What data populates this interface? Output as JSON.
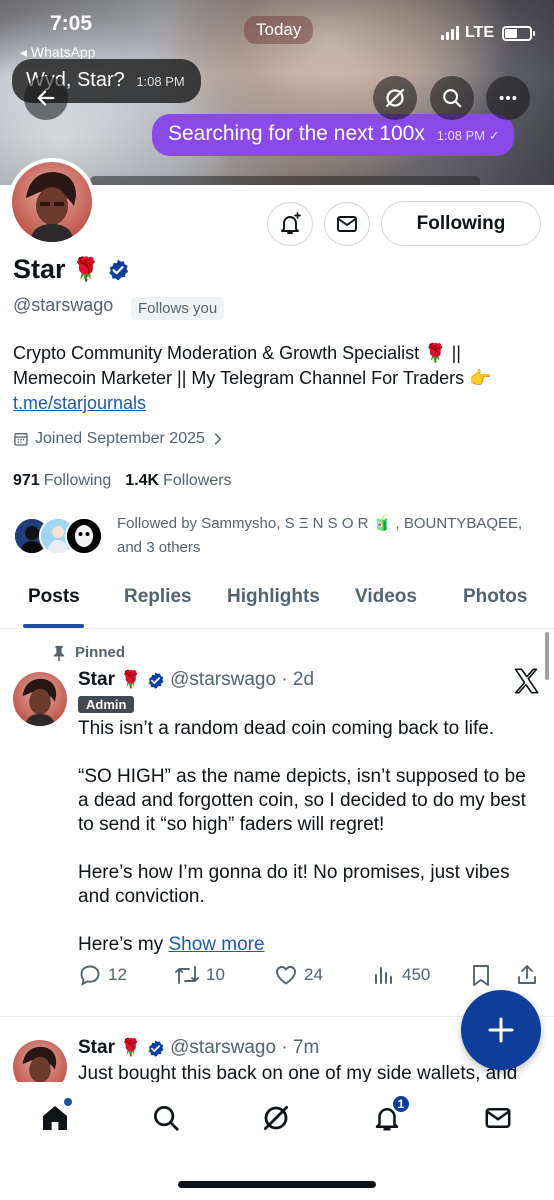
{
  "status_bar": {
    "time": "7:05",
    "back_app": "◂ WhatsApp",
    "network": "LTE"
  },
  "banner_overlay": {
    "date_pill": "Today",
    "incoming_message": "Wyd, Star?",
    "incoming_time": "1:08 PM",
    "outgoing_message": "Searching for the next 100x",
    "outgoing_time": "1:08 PM ✓"
  },
  "profile": {
    "name": "Star",
    "name_emoji": "🌹",
    "handle": "@starswago",
    "follows_you": "Follows you",
    "following_button": "Following",
    "bio_line1": "Crypto Community Moderation & Growth Specialist 🌹 ||",
    "bio_line2": "Memecoin Marketer || My Telegram Channel For Traders 👉",
    "bio_link": "t.me/starjournals",
    "joined": "Joined September 2025",
    "following_count": "971",
    "following_label": "Following",
    "followers_count": "1.4K",
    "followers_label": "Followers",
    "followed_by": "Followed by Sammysho, S Ξ N S O R 🧃 , BOUNTYBAQEE, and 3 others"
  },
  "tabs": [
    {
      "label": "Posts"
    },
    {
      "label": "Replies"
    },
    {
      "label": "Highlights"
    },
    {
      "label": "Videos"
    },
    {
      "label": "Photos"
    }
  ],
  "pinned_post": {
    "pinned_label": "Pinned",
    "name": "Star",
    "name_emoji": "🌹",
    "handle_time": "@starswago · 2d",
    "badge": "Admin",
    "p1": "This isn’t a random dead coin coming back to life.",
    "p2": "“SO HIGH” as the name depicts, isn’t supposed to be a dead and forgotten coin, so I decided to do my best to send it “so high” faders will regret!",
    "p3": "Here’s how I’m gonna do it! No promises, just vibes and conviction.",
    "p4": "Here’s my ",
    "show_more": "Show more",
    "replies": "12",
    "reposts": "10",
    "likes": "24",
    "views": "450"
  },
  "second_post": {
    "name": "Star",
    "name_emoji": "🌹",
    "handle_time": "@starswago · 7m",
    "text": "Just bought this back on one of my side wallets, and"
  },
  "bottom_nav": {
    "notifications_badge": "1"
  },
  "colors": {
    "accent": "#0d3f9a",
    "link": "#1d5da0",
    "verified": "#0d3f9a",
    "chat_bubble": "#8a49e8"
  }
}
